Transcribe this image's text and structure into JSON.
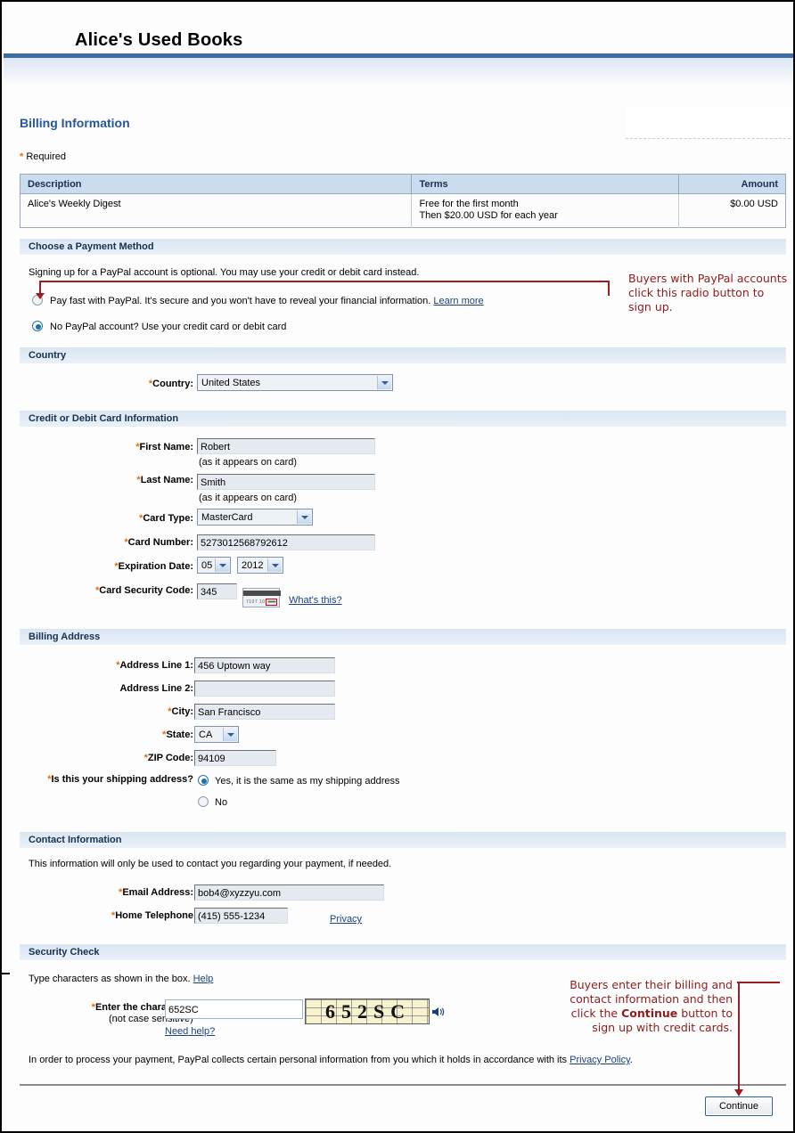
{
  "site": {
    "logo_title": "Alice's Used Books"
  },
  "page": {
    "title": "Billing Information",
    "required_note": "Required",
    "required_star": "*"
  },
  "summary_table": {
    "headers": [
      "Description",
      "Terms",
      "Amount"
    ],
    "rows": [
      {
        "description": "Alice's Weekly Digest",
        "terms_line1": "Free for the first month",
        "terms_line2": "Then $20.00 USD for each year",
        "amount": "$0.00 USD"
      }
    ]
  },
  "payment_method": {
    "section_title": "Choose a Payment Method",
    "intro": "Signing up for a PayPal account is optional. You may use your credit or debit card instead.",
    "option_paypal": "Pay fast with PayPal. It's secure and you won't have to reveal your financial information.",
    "option_paypal_link": "Learn more",
    "option_card": "No PayPal account? Use your credit card or debit card",
    "selected": "card"
  },
  "country_section": {
    "section_title": "Country",
    "label": "Country:",
    "value": "United States"
  },
  "card_section": {
    "section_title": "Credit or Debit Card Information",
    "first_name_label": "First Name:",
    "first_name_value": "Robert",
    "first_name_hint": "(as it appears on card)",
    "last_name_label": "Last Name:",
    "last_name_value": "Smith",
    "last_name_hint": "(as it appears on card)",
    "card_type_label": "Card Type:",
    "card_type_value": "MasterCard",
    "card_number_label": "Card Number:",
    "card_number_value": "5273012568792612",
    "expiration_label": "Expiration Date:",
    "expiration_month": "05",
    "expiration_year": "2012",
    "security_code_label": "Card Security Code:",
    "security_code_value": "345",
    "whats_this_link": "What's this?"
  },
  "billing_address": {
    "section_title": "Billing Address",
    "address1_label": "Address Line 1:",
    "address1_value": "456 Uptown way",
    "address2_label": "Address Line 2:",
    "address2_value": "",
    "city_label": "City:",
    "city_value": "San Francisco",
    "state_label": "State:",
    "state_value": "CA",
    "zip_label": "ZIP Code:",
    "zip_value": "94109",
    "shipping_question": "Is this your shipping address?",
    "shipping_yes": "Yes, it is the same as my shipping address",
    "shipping_no": "No",
    "shipping_selected": "yes"
  },
  "contact": {
    "section_title": "Contact Information",
    "intro": "This information will only be used to contact you regarding your payment, if needed.",
    "email_label": "Email Address:",
    "email_value": "bob4@xyzzyu.com",
    "phone_label": "Home Telephone",
    "phone_value": "(415) 555-1234",
    "privacy_link": "Privacy"
  },
  "security_check": {
    "section_title": "Security Check",
    "intro": "Type characters as shown in the box.",
    "intro_link": "Help",
    "enter_label": "Enter the characters:",
    "enter_sublabel": "(not case sensitive)",
    "enter_value": "652SC",
    "need_help_link": "Need help?",
    "captcha_text": "652SC"
  },
  "footer": {
    "disclaimer_prefix": "In order to process your payment, PayPal collects certain personal information from you which it holds in accordance with its ",
    "disclaimer_link": "Privacy Policy",
    "disclaimer_suffix": ".",
    "continue_label": "Continue"
  },
  "annotations": {
    "paypal_radio": "Buyers with PayPal accounts click this radio button to sign up.",
    "continue_line1": "Buyers enter their billing and",
    "continue_line2_a": "contact information and then",
    "continue_line3_a": "click the ",
    "continue_bold": "Continue",
    "continue_line3_b": " button to",
    "continue_line4": "sign up with credit cards."
  },
  "colors": {
    "header_rule": "#3c6ca8",
    "title_blue": "#26579e",
    "required_orange": "#e06c12",
    "link_blue": "#16418a",
    "annotation_red": "#8f1b1b",
    "table_header": "#ccdcef",
    "section_bar": "#dbe6f3"
  }
}
